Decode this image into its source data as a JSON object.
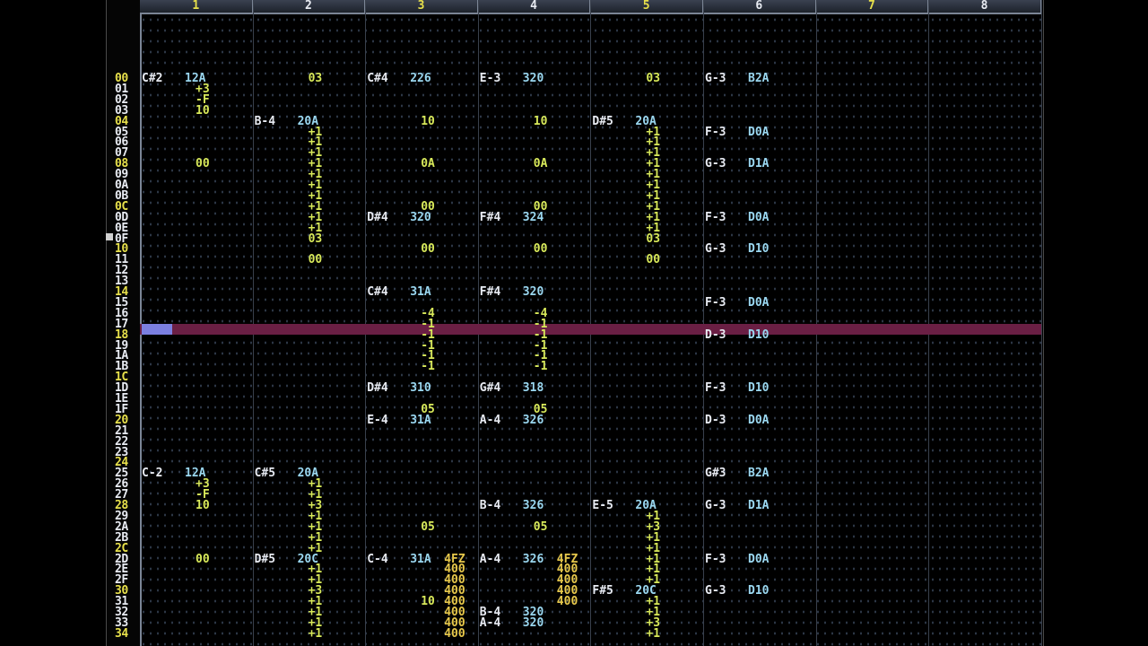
{
  "channels": [
    "1",
    "2",
    "3",
    "4",
    "5",
    "6",
    "7",
    "8"
  ],
  "channel_colors": [
    "#e7e04b",
    "#e8ebf2",
    "#e7e04b",
    "#e8ebf2",
    "#e7e04b",
    "#e8ebf2",
    "#e7e04b",
    "#e8ebf2"
  ],
  "row_labels": [
    "00",
    "01",
    "02",
    "03",
    "04",
    "05",
    "06",
    "07",
    "08",
    "09",
    "0A",
    "0B",
    "0C",
    "0D",
    "0E",
    "0F",
    "10",
    "11",
    "12",
    "13",
    "14",
    "15",
    "16",
    "17",
    "18",
    "19",
    "1A",
    "1B",
    "1C",
    "1D",
    "1E",
    "1F",
    "20",
    "21",
    "22",
    "23",
    "24",
    "25",
    "26",
    "27",
    "28",
    "29",
    "2A",
    "2B",
    "2C",
    "2D",
    "2E",
    "2F",
    "30",
    "31",
    "32",
    "33",
    "34"
  ],
  "highlighted_row": "17",
  "cells": [
    {
      "row": 0,
      "ch": 0,
      "text": "C#2",
      "k": "note"
    },
    {
      "row": 0,
      "ch": 0,
      "off": 48,
      "text": "12A",
      "k": "val"
    },
    {
      "row": 0,
      "ch": 1,
      "off": 60,
      "text": "03",
      "k": "num"
    },
    {
      "row": 0,
      "ch": 2,
      "text": "C#4",
      "k": "note"
    },
    {
      "row": 0,
      "ch": 2,
      "off": 48,
      "text": "226",
      "k": "val"
    },
    {
      "row": 0,
      "ch": 3,
      "text": "E-3",
      "k": "note"
    },
    {
      "row": 0,
      "ch": 3,
      "off": 48,
      "text": "320",
      "k": "val"
    },
    {
      "row": 0,
      "ch": 4,
      "off": 60,
      "text": "03",
      "k": "num"
    },
    {
      "row": 0,
      "ch": 5,
      "text": "G-3",
      "k": "note"
    },
    {
      "row": 0,
      "ch": 5,
      "off": 48,
      "text": "B2A",
      "k": "val"
    },
    {
      "row": 1,
      "ch": 0,
      "off": 60,
      "text": "+3",
      "k": "num"
    },
    {
      "row": 2,
      "ch": 0,
      "off": 60,
      "text": "-F",
      "k": "num"
    },
    {
      "row": 3,
      "ch": 0,
      "off": 60,
      "text": "10",
      "k": "num"
    },
    {
      "row": 4,
      "ch": 1,
      "text": "B-4",
      "k": "note"
    },
    {
      "row": 4,
      "ch": 1,
      "off": 48,
      "text": "20A",
      "k": "val"
    },
    {
      "row": 4,
      "ch": 2,
      "off": 60,
      "text": "10",
      "k": "num"
    },
    {
      "row": 4,
      "ch": 3,
      "off": 60,
      "text": "10",
      "k": "num"
    },
    {
      "row": 4,
      "ch": 4,
      "text": "D#5",
      "k": "note"
    },
    {
      "row": 4,
      "ch": 4,
      "off": 48,
      "text": "20A",
      "k": "val"
    },
    {
      "row": 5,
      "ch": 1,
      "off": 60,
      "text": "+1",
      "k": "num"
    },
    {
      "row": 5,
      "ch": 4,
      "off": 60,
      "text": "+1",
      "k": "num"
    },
    {
      "row": 5,
      "ch": 5,
      "text": "F-3",
      "k": "note"
    },
    {
      "row": 5,
      "ch": 5,
      "off": 48,
      "text": "D0A",
      "k": "val"
    },
    {
      "row": 6,
      "ch": 1,
      "off": 60,
      "text": "+1",
      "k": "num"
    },
    {
      "row": 6,
      "ch": 4,
      "off": 60,
      "text": "+1",
      "k": "num"
    },
    {
      "row": 7,
      "ch": 1,
      "off": 60,
      "text": "+1",
      "k": "num"
    },
    {
      "row": 7,
      "ch": 4,
      "off": 60,
      "text": "+1",
      "k": "num"
    },
    {
      "row": 8,
      "ch": 0,
      "off": 60,
      "text": "00",
      "k": "num"
    },
    {
      "row": 8,
      "ch": 1,
      "off": 60,
      "text": "+1",
      "k": "num"
    },
    {
      "row": 8,
      "ch": 2,
      "off": 60,
      "text": "0A",
      "k": "num"
    },
    {
      "row": 8,
      "ch": 3,
      "off": 60,
      "text": "0A",
      "k": "num"
    },
    {
      "row": 8,
      "ch": 4,
      "off": 60,
      "text": "+1",
      "k": "num"
    },
    {
      "row": 8,
      "ch": 5,
      "text": "G-3",
      "k": "note"
    },
    {
      "row": 8,
      "ch": 5,
      "off": 48,
      "text": "D1A",
      "k": "val"
    },
    {
      "row": 9,
      "ch": 1,
      "off": 60,
      "text": "+1",
      "k": "num"
    },
    {
      "row": 9,
      "ch": 4,
      "off": 60,
      "text": "+1",
      "k": "num"
    },
    {
      "row": 10,
      "ch": 1,
      "off": 60,
      "text": "+1",
      "k": "num"
    },
    {
      "row": 10,
      "ch": 4,
      "off": 60,
      "text": "+1",
      "k": "num"
    },
    {
      "row": 11,
      "ch": 1,
      "off": 60,
      "text": "+1",
      "k": "num"
    },
    {
      "row": 11,
      "ch": 4,
      "off": 60,
      "text": "+1",
      "k": "num"
    },
    {
      "row": 12,
      "ch": 1,
      "off": 60,
      "text": "+1",
      "k": "num"
    },
    {
      "row": 12,
      "ch": 2,
      "off": 60,
      "text": "00",
      "k": "num"
    },
    {
      "row": 12,
      "ch": 3,
      "off": 60,
      "text": "00",
      "k": "num"
    },
    {
      "row": 12,
      "ch": 4,
      "off": 60,
      "text": "+1",
      "k": "num"
    },
    {
      "row": 13,
      "ch": 1,
      "off": 60,
      "text": "+1",
      "k": "num"
    },
    {
      "row": 13,
      "ch": 2,
      "text": "D#4",
      "k": "note"
    },
    {
      "row": 13,
      "ch": 2,
      "off": 48,
      "text": "320",
      "k": "val"
    },
    {
      "row": 13,
      "ch": 3,
      "text": "F#4",
      "k": "note"
    },
    {
      "row": 13,
      "ch": 3,
      "off": 48,
      "text": "324",
      "k": "val"
    },
    {
      "row": 13,
      "ch": 4,
      "off": 60,
      "text": "+1",
      "k": "num"
    },
    {
      "row": 13,
      "ch": 5,
      "text": "F-3",
      "k": "note"
    },
    {
      "row": 13,
      "ch": 5,
      "off": 48,
      "text": "D0A",
      "k": "val"
    },
    {
      "row": 14,
      "ch": 1,
      "off": 60,
      "text": "+1",
      "k": "num"
    },
    {
      "row": 14,
      "ch": 4,
      "off": 60,
      "text": "+1",
      "k": "num"
    },
    {
      "row": 15,
      "ch": 1,
      "off": 60,
      "text": "03",
      "k": "num"
    },
    {
      "row": 15,
      "ch": 4,
      "off": 60,
      "text": "03",
      "k": "num"
    },
    {
      "row": 16,
      "ch": 2,
      "off": 60,
      "text": "00",
      "k": "num"
    },
    {
      "row": 16,
      "ch": 3,
      "off": 60,
      "text": "00",
      "k": "num"
    },
    {
      "row": 16,
      "ch": 5,
      "text": "G-3",
      "k": "note"
    },
    {
      "row": 16,
      "ch": 5,
      "off": 48,
      "text": "D10",
      "k": "val"
    },
    {
      "row": 17,
      "ch": 1,
      "off": 60,
      "text": "00",
      "k": "num"
    },
    {
      "row": 17,
      "ch": 4,
      "off": 60,
      "text": "00",
      "k": "num"
    },
    {
      "row": 20,
      "ch": 2,
      "text": "C#4",
      "k": "note"
    },
    {
      "row": 20,
      "ch": 2,
      "off": 48,
      "text": "31A",
      "k": "val"
    },
    {
      "row": 20,
      "ch": 3,
      "text": "F#4",
      "k": "note"
    },
    {
      "row": 20,
      "ch": 3,
      "off": 48,
      "text": "320",
      "k": "val"
    },
    {
      "row": 21,
      "ch": 5,
      "text": "F-3",
      "k": "note"
    },
    {
      "row": 21,
      "ch": 5,
      "off": 48,
      "text": "D0A",
      "k": "val"
    },
    {
      "row": 22,
      "ch": 2,
      "off": 60,
      "text": "-4",
      "k": "num"
    },
    {
      "row": 22,
      "ch": 3,
      "off": 60,
      "text": "-4",
      "k": "num"
    },
    {
      "row": 23,
      "ch": 2,
      "off": 60,
      "text": "-1",
      "k": "num"
    },
    {
      "row": 23,
      "ch": 3,
      "off": 60,
      "text": "-1",
      "k": "num"
    },
    {
      "row": 24,
      "ch": 2,
      "off": 60,
      "text": "-1",
      "k": "num"
    },
    {
      "row": 24,
      "ch": 3,
      "off": 60,
      "text": "-1",
      "k": "num"
    },
    {
      "row": 24,
      "ch": 5,
      "text": "D-3",
      "k": "note"
    },
    {
      "row": 24,
      "ch": 5,
      "off": 48,
      "text": "D10",
      "k": "val"
    },
    {
      "row": 25,
      "ch": 2,
      "off": 60,
      "text": "-1",
      "k": "num"
    },
    {
      "row": 25,
      "ch": 3,
      "off": 60,
      "text": "-1",
      "k": "num"
    },
    {
      "row": 26,
      "ch": 2,
      "off": 60,
      "text": "-1",
      "k": "num"
    },
    {
      "row": 26,
      "ch": 3,
      "off": 60,
      "text": "-1",
      "k": "num"
    },
    {
      "row": 27,
      "ch": 2,
      "off": 60,
      "text": "-1",
      "k": "num"
    },
    {
      "row": 27,
      "ch": 3,
      "off": 60,
      "text": "-1",
      "k": "num"
    },
    {
      "row": 29,
      "ch": 2,
      "text": "D#4",
      "k": "note"
    },
    {
      "row": 29,
      "ch": 2,
      "off": 48,
      "text": "310",
      "k": "val"
    },
    {
      "row": 29,
      "ch": 3,
      "text": "G#4",
      "k": "note"
    },
    {
      "row": 29,
      "ch": 3,
      "off": 48,
      "text": "318",
      "k": "val"
    },
    {
      "row": 29,
      "ch": 5,
      "text": "F-3",
      "k": "note"
    },
    {
      "row": 29,
      "ch": 5,
      "off": 48,
      "text": "D10",
      "k": "val"
    },
    {
      "row": 31,
      "ch": 2,
      "off": 60,
      "text": "05",
      "k": "num"
    },
    {
      "row": 31,
      "ch": 3,
      "off": 60,
      "text": "05",
      "k": "num"
    },
    {
      "row": 32,
      "ch": 2,
      "text": "E-4",
      "k": "note"
    },
    {
      "row": 32,
      "ch": 2,
      "off": 48,
      "text": "31A",
      "k": "val"
    },
    {
      "row": 32,
      "ch": 3,
      "text": "A-4",
      "k": "note"
    },
    {
      "row": 32,
      "ch": 3,
      "off": 48,
      "text": "326",
      "k": "val"
    },
    {
      "row": 32,
      "ch": 5,
      "text": "D-3",
      "k": "note"
    },
    {
      "row": 32,
      "ch": 5,
      "off": 48,
      "text": "D0A",
      "k": "val"
    },
    {
      "row": 37,
      "ch": 0,
      "text": "C-2",
      "k": "note"
    },
    {
      "row": 37,
      "ch": 0,
      "off": 48,
      "text": "12A",
      "k": "val"
    },
    {
      "row": 37,
      "ch": 1,
      "text": "C#5",
      "k": "note"
    },
    {
      "row": 37,
      "ch": 1,
      "off": 48,
      "text": "20A",
      "k": "val"
    },
    {
      "row": 37,
      "ch": 5,
      "text": "G#3",
      "k": "note"
    },
    {
      "row": 37,
      "ch": 5,
      "off": 48,
      "text": "B2A",
      "k": "val"
    },
    {
      "row": 38,
      "ch": 0,
      "off": 60,
      "text": "+3",
      "k": "num"
    },
    {
      "row": 38,
      "ch": 1,
      "off": 60,
      "text": "+1",
      "k": "num"
    },
    {
      "row": 39,
      "ch": 0,
      "off": 60,
      "text": "-F",
      "k": "num"
    },
    {
      "row": 39,
      "ch": 1,
      "off": 60,
      "text": "+1",
      "k": "num"
    },
    {
      "row": 40,
      "ch": 0,
      "off": 60,
      "text": "10",
      "k": "num"
    },
    {
      "row": 40,
      "ch": 1,
      "off": 60,
      "text": "+3",
      "k": "num"
    },
    {
      "row": 40,
      "ch": 3,
      "text": "B-4",
      "k": "note"
    },
    {
      "row": 40,
      "ch": 3,
      "off": 48,
      "text": "326",
      "k": "val"
    },
    {
      "row": 40,
      "ch": 4,
      "text": "E-5",
      "k": "note"
    },
    {
      "row": 40,
      "ch": 4,
      "off": 48,
      "text": "20A",
      "k": "val"
    },
    {
      "row": 40,
      "ch": 5,
      "text": "G-3",
      "k": "note"
    },
    {
      "row": 40,
      "ch": 5,
      "off": 48,
      "text": "D1A",
      "k": "val"
    },
    {
      "row": 41,
      "ch": 1,
      "off": 60,
      "text": "+1",
      "k": "num"
    },
    {
      "row": 41,
      "ch": 4,
      "off": 60,
      "text": "+1",
      "k": "num"
    },
    {
      "row": 42,
      "ch": 1,
      "off": 60,
      "text": "+1",
      "k": "num"
    },
    {
      "row": 42,
      "ch": 2,
      "off": 60,
      "text": "05",
      "k": "num"
    },
    {
      "row": 42,
      "ch": 3,
      "off": 60,
      "text": "05",
      "k": "num"
    },
    {
      "row": 42,
      "ch": 4,
      "off": 60,
      "text": "+3",
      "k": "num"
    },
    {
      "row": 43,
      "ch": 1,
      "off": 60,
      "text": "+1",
      "k": "num"
    },
    {
      "row": 43,
      "ch": 4,
      "off": 60,
      "text": "+1",
      "k": "num"
    },
    {
      "row": 44,
      "ch": 1,
      "off": 60,
      "text": "+1",
      "k": "num"
    },
    {
      "row": 44,
      "ch": 4,
      "off": 60,
      "text": "+1",
      "k": "num"
    },
    {
      "row": 45,
      "ch": 0,
      "off": 60,
      "text": "00",
      "k": "num"
    },
    {
      "row": 45,
      "ch": 1,
      "text": "D#5",
      "k": "note"
    },
    {
      "row": 45,
      "ch": 1,
      "off": 48,
      "text": "20C",
      "k": "val"
    },
    {
      "row": 45,
      "ch": 2,
      "text": "C-4",
      "k": "note"
    },
    {
      "row": 45,
      "ch": 2,
      "off": 48,
      "text": "31A",
      "k": "val"
    },
    {
      "row": 45,
      "ch": 2,
      "off": 86,
      "text": "4FZ",
      "k": "fx"
    },
    {
      "row": 45,
      "ch": 3,
      "text": "A-4",
      "k": "note"
    },
    {
      "row": 45,
      "ch": 3,
      "off": 48,
      "text": "326",
      "k": "val"
    },
    {
      "row": 45,
      "ch": 3,
      "off": 86,
      "text": "4FZ",
      "k": "fx"
    },
    {
      "row": 45,
      "ch": 4,
      "off": 60,
      "text": "+1",
      "k": "num"
    },
    {
      "row": 45,
      "ch": 5,
      "text": "F-3",
      "k": "note"
    },
    {
      "row": 45,
      "ch": 5,
      "off": 48,
      "text": "D0A",
      "k": "val"
    },
    {
      "row": 46,
      "ch": 1,
      "off": 60,
      "text": "+1",
      "k": "num"
    },
    {
      "row": 46,
      "ch": 2,
      "off": 86,
      "text": "400",
      "k": "fx"
    },
    {
      "row": 46,
      "ch": 3,
      "off": 86,
      "text": "400",
      "k": "fx"
    },
    {
      "row": 46,
      "ch": 4,
      "off": 60,
      "text": "+1",
      "k": "num"
    },
    {
      "row": 47,
      "ch": 1,
      "off": 60,
      "text": "+1",
      "k": "num"
    },
    {
      "row": 47,
      "ch": 2,
      "off": 86,
      "text": "400",
      "k": "fx"
    },
    {
      "row": 47,
      "ch": 3,
      "off": 86,
      "text": "400",
      "k": "fx"
    },
    {
      "row": 47,
      "ch": 4,
      "off": 60,
      "text": "+1",
      "k": "num"
    },
    {
      "row": 48,
      "ch": 1,
      "off": 60,
      "text": "+3",
      "k": "num"
    },
    {
      "row": 48,
      "ch": 2,
      "off": 86,
      "text": "400",
      "k": "fx"
    },
    {
      "row": 48,
      "ch": 3,
      "off": 86,
      "text": "400",
      "k": "fx"
    },
    {
      "row": 48,
      "ch": 4,
      "text": "F#5",
      "k": "note"
    },
    {
      "row": 48,
      "ch": 4,
      "off": 48,
      "text": "20C",
      "k": "val"
    },
    {
      "row": 48,
      "ch": 5,
      "text": "G-3",
      "k": "note"
    },
    {
      "row": 48,
      "ch": 5,
      "off": 48,
      "text": "D10",
      "k": "val"
    },
    {
      "row": 49,
      "ch": 1,
      "off": 60,
      "text": "+1",
      "k": "num"
    },
    {
      "row": 49,
      "ch": 2,
      "off": 60,
      "text": "10",
      "k": "num"
    },
    {
      "row": 49,
      "ch": 2,
      "off": 86,
      "text": "400",
      "k": "fx"
    },
    {
      "row": 49,
      "ch": 3,
      "off": 86,
      "text": "400",
      "k": "fx"
    },
    {
      "row": 49,
      "ch": 4,
      "off": 60,
      "text": "+1",
      "k": "num"
    },
    {
      "row": 50,
      "ch": 1,
      "off": 60,
      "text": "+1",
      "k": "num"
    },
    {
      "row": 50,
      "ch": 2,
      "off": 86,
      "text": "400",
      "k": "fx"
    },
    {
      "row": 50,
      "ch": 3,
      "text": "B-4",
      "k": "note"
    },
    {
      "row": 50,
      "ch": 3,
      "off": 48,
      "text": "320",
      "k": "val"
    },
    {
      "row": 50,
      "ch": 4,
      "off": 60,
      "text": "+1",
      "k": "num"
    },
    {
      "row": 51,
      "ch": 1,
      "off": 60,
      "text": "+1",
      "k": "num"
    },
    {
      "row": 51,
      "ch": 2,
      "off": 86,
      "text": "400",
      "k": "fx"
    },
    {
      "row": 51,
      "ch": 3,
      "text": "A-4",
      "k": "note"
    },
    {
      "row": 51,
      "ch": 3,
      "off": 48,
      "text": "320",
      "k": "val"
    },
    {
      "row": 51,
      "ch": 4,
      "off": 60,
      "text": "+3",
      "k": "num"
    },
    {
      "row": 52,
      "ch": 1,
      "off": 60,
      "text": "+1",
      "k": "num"
    },
    {
      "row": 52,
      "ch": 2,
      "off": 86,
      "text": "400",
      "k": "fx"
    },
    {
      "row": 52,
      "ch": 4,
      "off": 60,
      "text": "+1",
      "k": "num"
    }
  ]
}
